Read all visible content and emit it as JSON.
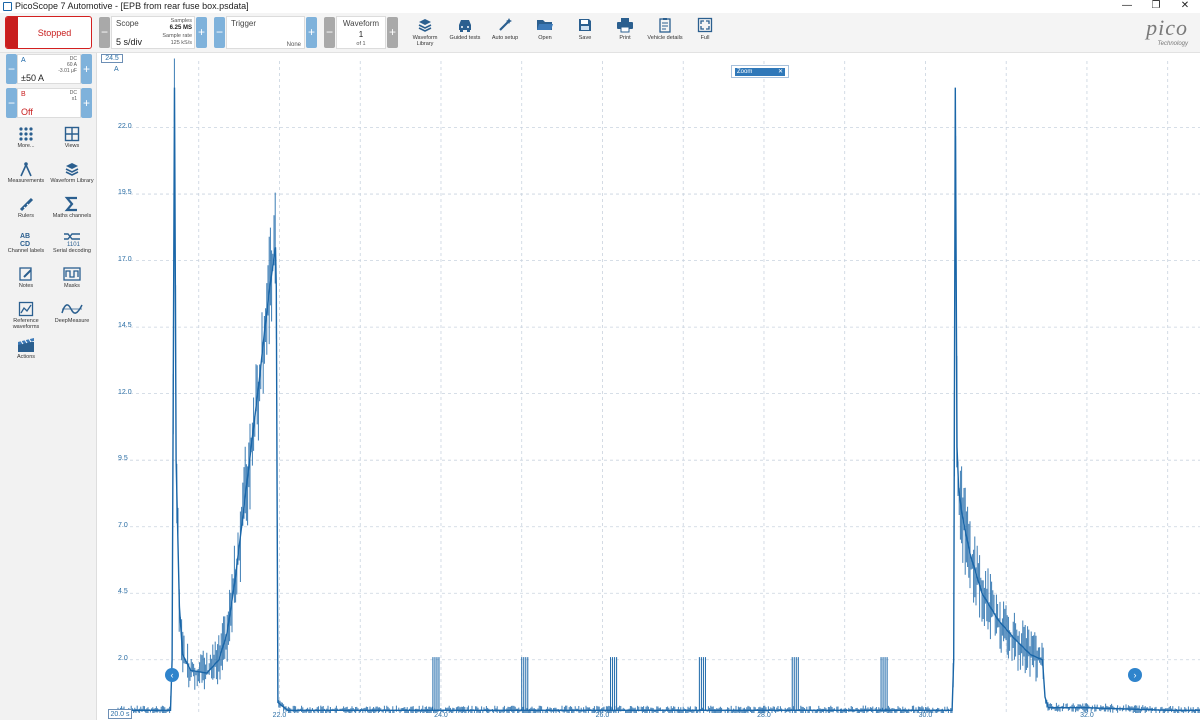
{
  "window": {
    "title": "PicoScope 7 Automotive - [EPB from rear fuse box.psdata]",
    "minimize": "—",
    "maximize": "❐",
    "close": "✕"
  },
  "toolbar": {
    "run_state": "Stopped",
    "scope": {
      "title": "Scope",
      "timebase": "5 s/div",
      "samples_label": "Samples",
      "samples_value": "6.25 MS",
      "rate_label": "Sample rate",
      "rate_value": "125 kS/s"
    },
    "trigger": {
      "title": "Trigger",
      "mode": "None"
    },
    "waveform": {
      "title": "Waveform",
      "index": "1",
      "of": "of 1"
    },
    "tools": [
      {
        "label": "Waveform Library",
        "icon": "waveform-library-icon"
      },
      {
        "label": "Guided tests",
        "icon": "car-icon"
      },
      {
        "label": "Auto setup",
        "icon": "wand-icon"
      },
      {
        "label": "Open",
        "icon": "folder-icon"
      },
      {
        "label": "Save",
        "icon": "save-icon"
      },
      {
        "label": "Print",
        "icon": "printer-icon"
      },
      {
        "label": "Vehicle details",
        "icon": "clipboard-icon"
      },
      {
        "label": "Full",
        "icon": "fullscreen-icon"
      }
    ],
    "logo": {
      "word": "pico",
      "sub": "Technology"
    }
  },
  "channels": [
    {
      "name": "A",
      "range": "±50 A",
      "coupling": "DC",
      "probe": "60 A",
      "extra": "-3.01 μF",
      "color": "#1a66a8"
    },
    {
      "name": "B",
      "range": "Off",
      "coupling": "DC",
      "probe": "x1",
      "extra": "",
      "color": "#c81e1e"
    }
  ],
  "side_tools": [
    {
      "label": "More...",
      "icon": "grid-dots-icon"
    },
    {
      "label": "Views",
      "icon": "views-icon"
    },
    {
      "label": "Measurements",
      "icon": "compass-icon"
    },
    {
      "label": "Waveform Library",
      "icon": "waveform-library-icon"
    },
    {
      "label": "Rulers",
      "icon": "ruler-icon"
    },
    {
      "label": "Maths channels",
      "icon": "sigma-icon"
    },
    {
      "label": "Channel labels",
      "icon": "channel-labels-icon"
    },
    {
      "label": "Serial decoding",
      "icon": "serial-decoding-icon"
    },
    {
      "label": "Notes",
      "icon": "notes-icon"
    },
    {
      "label": "Masks",
      "icon": "masks-icon"
    },
    {
      "label": "Reference waveforms",
      "icon": "reference-waveforms-icon"
    },
    {
      "label": "DeepMeasure",
      "icon": "deepmeasure-icon"
    },
    {
      "label": "Actions",
      "icon": "actions-icon"
    }
  ],
  "plot": {
    "y_top_label": "24.5",
    "y_unit": "A",
    "x_start_label": "20.0 s",
    "zoom_label": "Zoom",
    "colors": {
      "trace": "#1a66a8",
      "grid": "#c9d3df",
      "axis_text": "#2b6ea5"
    }
  },
  "chart_data": {
    "type": "line",
    "title": "",
    "xlabel": "",
    "ylabel": "A",
    "x_unit": "s",
    "xlim": [
      20.0,
      33.4
    ],
    "ylim": [
      0.0,
      24.5
    ],
    "y_ticks": [
      "2.0",
      "4.5",
      "7.0",
      "9.5",
      "12.0",
      "14.5",
      "17.0",
      "19.5",
      "22.0"
    ],
    "x_ticks": [
      "22.0",
      "24.0",
      "26.0",
      "28.0",
      "30.0",
      "32.0"
    ],
    "grid": true,
    "series": [
      {
        "name": "",
        "x": [
          20.0,
          20.65,
          20.67,
          20.7,
          20.72,
          20.76,
          20.8,
          20.9,
          21.1,
          21.25,
          21.35,
          21.45,
          21.55,
          21.65,
          21.75,
          21.82,
          21.88,
          21.95,
          21.96,
          21.98,
          22.1,
          23.0,
          24.0,
          25.0,
          26.0,
          27.0,
          28.0,
          29.0,
          30.0,
          30.33,
          30.35,
          30.37,
          30.39,
          30.41,
          30.45,
          30.55,
          30.7,
          30.9,
          31.1,
          31.3,
          31.45,
          31.48,
          31.52,
          32.0,
          33.0,
          33.4
        ],
        "values": [
          0.1,
          0.1,
          2.0,
          23.5,
          9.5,
          4.0,
          2.2,
          1.6,
          1.5,
          2.0,
          3.0,
          5.0,
          7.5,
          10.0,
          12.5,
          14.5,
          16.0,
          17.5,
          16.0,
          0.4,
          0.1,
          0.1,
          0.1,
          0.1,
          0.1,
          0.1,
          0.1,
          0.1,
          0.1,
          0.1,
          2.0,
          23.5,
          10.0,
          8.5,
          7.5,
          6.0,
          4.5,
          3.5,
          2.8,
          2.2,
          2.0,
          0.6,
          0.2,
          0.2,
          0.1,
          0.1
        ]
      }
    ]
  }
}
